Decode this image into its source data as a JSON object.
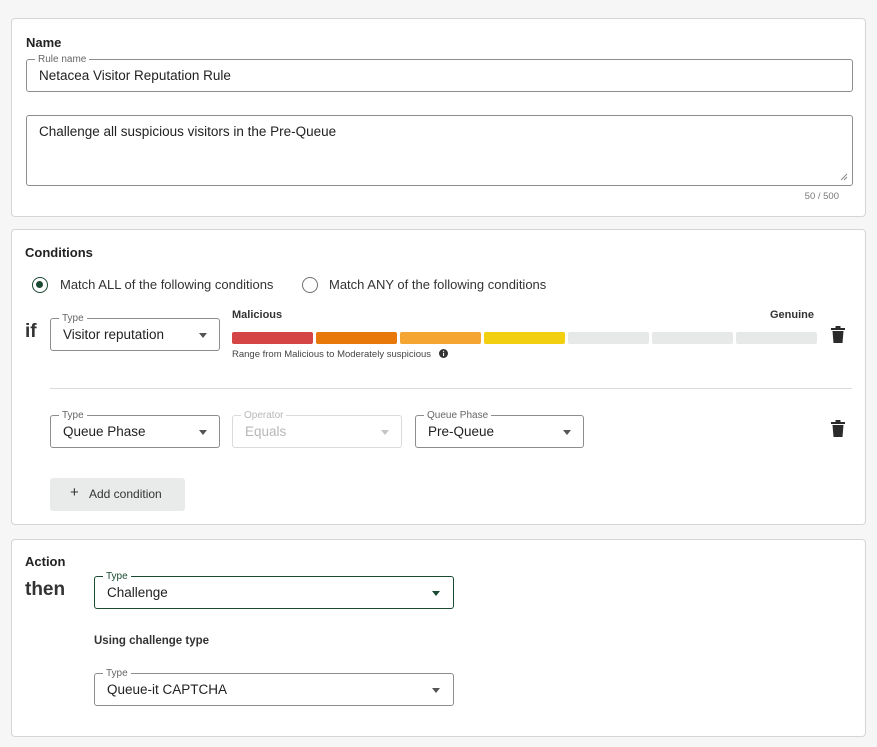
{
  "name_section": {
    "title": "Name",
    "rule_name_legend": "Rule name",
    "rule_name_value": "Netacea Visitor Reputation Rule",
    "description_value": "Challenge all suspicious visitors in the Pre-Queue",
    "char_count": "50 / 500"
  },
  "conditions": {
    "title": "Conditions",
    "match_all_label": "Match ALL of the following conditions",
    "match_any_label": "Match ANY of the following conditions",
    "selected_match": "all",
    "if_label": "if",
    "condition1": {
      "type_legend": "Type",
      "type_value": "Visitor reputation",
      "scale_left": "Malicious",
      "scale_right": "Genuine",
      "range_caption": "Range from Malicious to Moderately suspicious",
      "segment_colors": [
        "#d64545",
        "#e8780a",
        "#f5a532",
        "#f2cf10",
        "#e7e9e8",
        "#e7e9e8",
        "#e7e9e8"
      ],
      "selected_segments": 4
    },
    "condition2": {
      "type_legend": "Type",
      "type_value": "Queue Phase",
      "operator_legend": "Operator",
      "operator_value": "Equals",
      "phase_legend": "Queue Phase",
      "phase_value": "Pre-Queue"
    },
    "add_condition_label": "Add condition"
  },
  "action": {
    "title": "Action",
    "then_label": "then",
    "type_legend": "Type",
    "type_value": "Challenge",
    "challenge_heading": "Using challenge type",
    "challenge_type_legend": "Type",
    "challenge_type_value": "Queue-it CAPTCHA"
  },
  "colors": {
    "accent": "#1b4a33",
    "border": "#d3d6d4"
  }
}
